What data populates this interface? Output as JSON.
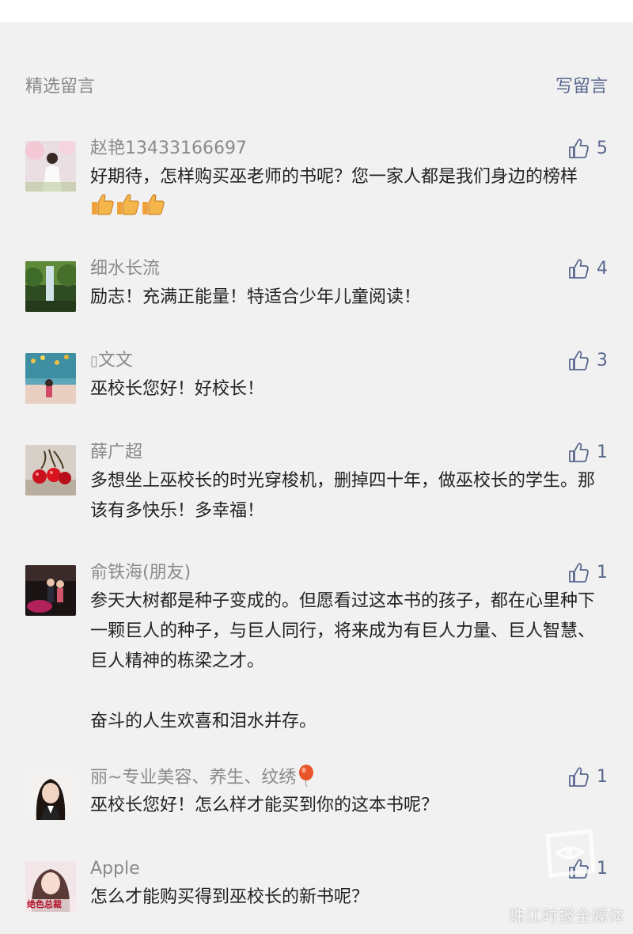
{
  "header": {
    "title": "精选留言",
    "write_label": "写留言"
  },
  "comments": [
    {
      "name": "赵艳13433166697",
      "text": "好期待，怎样购买巫老师的书呢？您一家人都是我们身边的榜样",
      "likes": "5",
      "emoji_thumbs": 3
    },
    {
      "name": "细水长流",
      "text": "励志！充满正能量！特适合少年儿童阅读！",
      "likes": "4"
    },
    {
      "name": "文文",
      "text": "巫校长您好！好校长！",
      "likes": "3"
    },
    {
      "name": "薛广超",
      "text": "多想坐上巫校长的时光穿梭机，删掉四十年，做巫校长的学生。那该有多快乐！多幸福！",
      "likes": "1"
    },
    {
      "name": "俞铁海(朋友)",
      "text": "参天大树都是种子变成的。但愿看过这本书的孩子，都在心里种下一颗巨人的种子，与巨人同行，将来成为有巨人力量、巨人智慧、巨人精神的栋梁之才。\n\n奋斗的人生欢喜和泪水并存。",
      "likes": "1"
    },
    {
      "name": "丽~专业美容、养生、纹绣",
      "text": "巫校长您好！怎么样才能买到你的这本书呢？",
      "likes": "1",
      "name_emoji": "balloon"
    },
    {
      "name": "Apple",
      "text": "怎么才能购买得到巫校长的新书呢？",
      "likes": "1",
      "avatar_text": "绝色总裁"
    }
  ],
  "watermark": {
    "text": "珠江时报全媒体"
  },
  "colors": {
    "panel_bg": "#f1f1f1",
    "link": "#58688e",
    "muted": "#8a8a8a",
    "text": "#222222"
  }
}
